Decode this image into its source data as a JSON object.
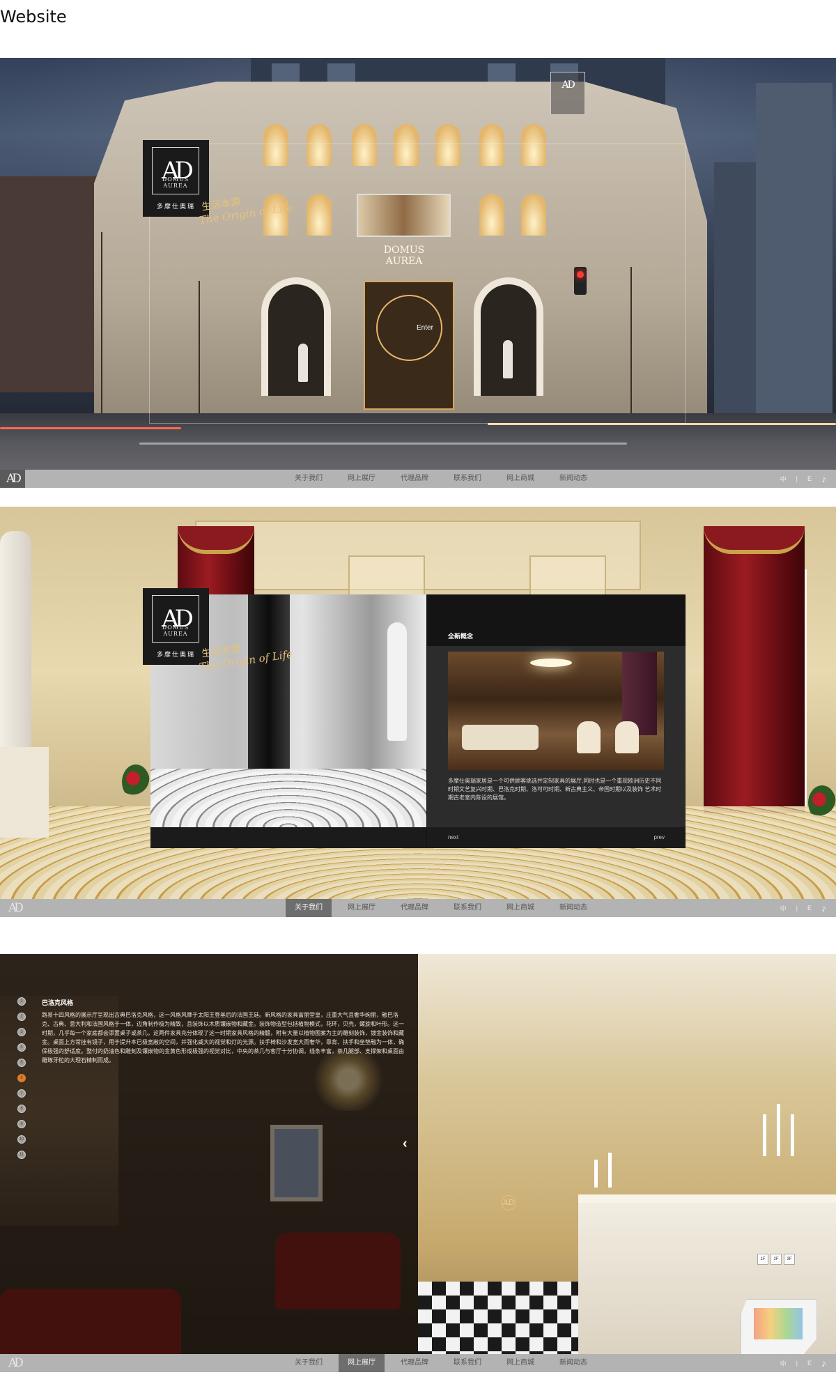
{
  "page_label": "Website",
  "brand": {
    "monogram": "AD",
    "name_line1": "DOMUS",
    "name_line2": "AUREA",
    "chinese_name": "多摩仕奥瑞",
    "tagline_cn": "生活本源",
    "tagline_en": "The Origin of Life"
  },
  "nav": {
    "items": [
      "关于我们",
      "网上展厅",
      "代理品牌",
      "联系我们",
      "网上商城",
      "新闻动态"
    ]
  },
  "section1": {
    "enter_label": "Enter",
    "facade_sign": "DOMUS AUREA",
    "bar_right": [
      "中",
      "|",
      "E"
    ],
    "active_nav": ""
  },
  "section2": {
    "active_nav": "关于我们",
    "panel_title": "全新概念",
    "panel_text": "多摩仕奥瑞家居是一个可供顾客挑选并定制家具的展厅,同时也是一个重现欧洲历史不同时期文艺复兴时期、巴洛克时期、洛可可时期、新古典主义、帝国时期以及装饰 艺术时期古老室内陈设的展馆。",
    "next_label": "next",
    "prev_label": "prev",
    "bar_right": [
      "中",
      "|",
      "E"
    ]
  },
  "section3": {
    "active_nav": "网上展厅",
    "title": "巴洛克风格",
    "body": "路易十四风格的展示厅呈现出古典巴洛克风格，这一风格风靡于太阳王登基后的法国王廷。新风格的家具富丽堂皇，庄重大气且奢华绚丽，融巴洛克、古典、意大利和法国风格于一体，边角制作极为精致，且装饰以木质镶嵌物和藏金。装饰物造型包括植物模式，花环，贝壳，螺旋和叶形。这一时期，几乎每一个家庭都会添置桌子或茶几，这两件家具充分体现了这一时期家具风格的精髓，附有大量以植物图案为主的雕刻装饰，镀金装饰和藏金。桌面上方常挂有镜子，用于提升本已极宽敞的空间，并强化威大的视觉和灯的光源。扶手椅和沙发宽大而奢华，靠背、扶手和坐垫融为一体，确保极强的舒适度。整付的奶油色和雕刻及镶嵌物的金黄色形成极强的视觉对比，中央的茶几与客厅十分协调，线条丰富，茶几腿部、支撑架和桌面由雕琢牙粒的大理石精制而成。",
    "dots": [
      "1",
      "2",
      "3",
      "4",
      "5",
      "6",
      "7",
      "8",
      "9",
      "10",
      "11"
    ],
    "active_dot": "6",
    "arrow": "‹",
    "floor_buttons": [
      "1F",
      "2F",
      "3F"
    ],
    "bar_right": [
      "中",
      "|",
      "E"
    ]
  },
  "icons": {
    "music": "music-note-icon",
    "mini_logo": "ad-logo-icon"
  }
}
